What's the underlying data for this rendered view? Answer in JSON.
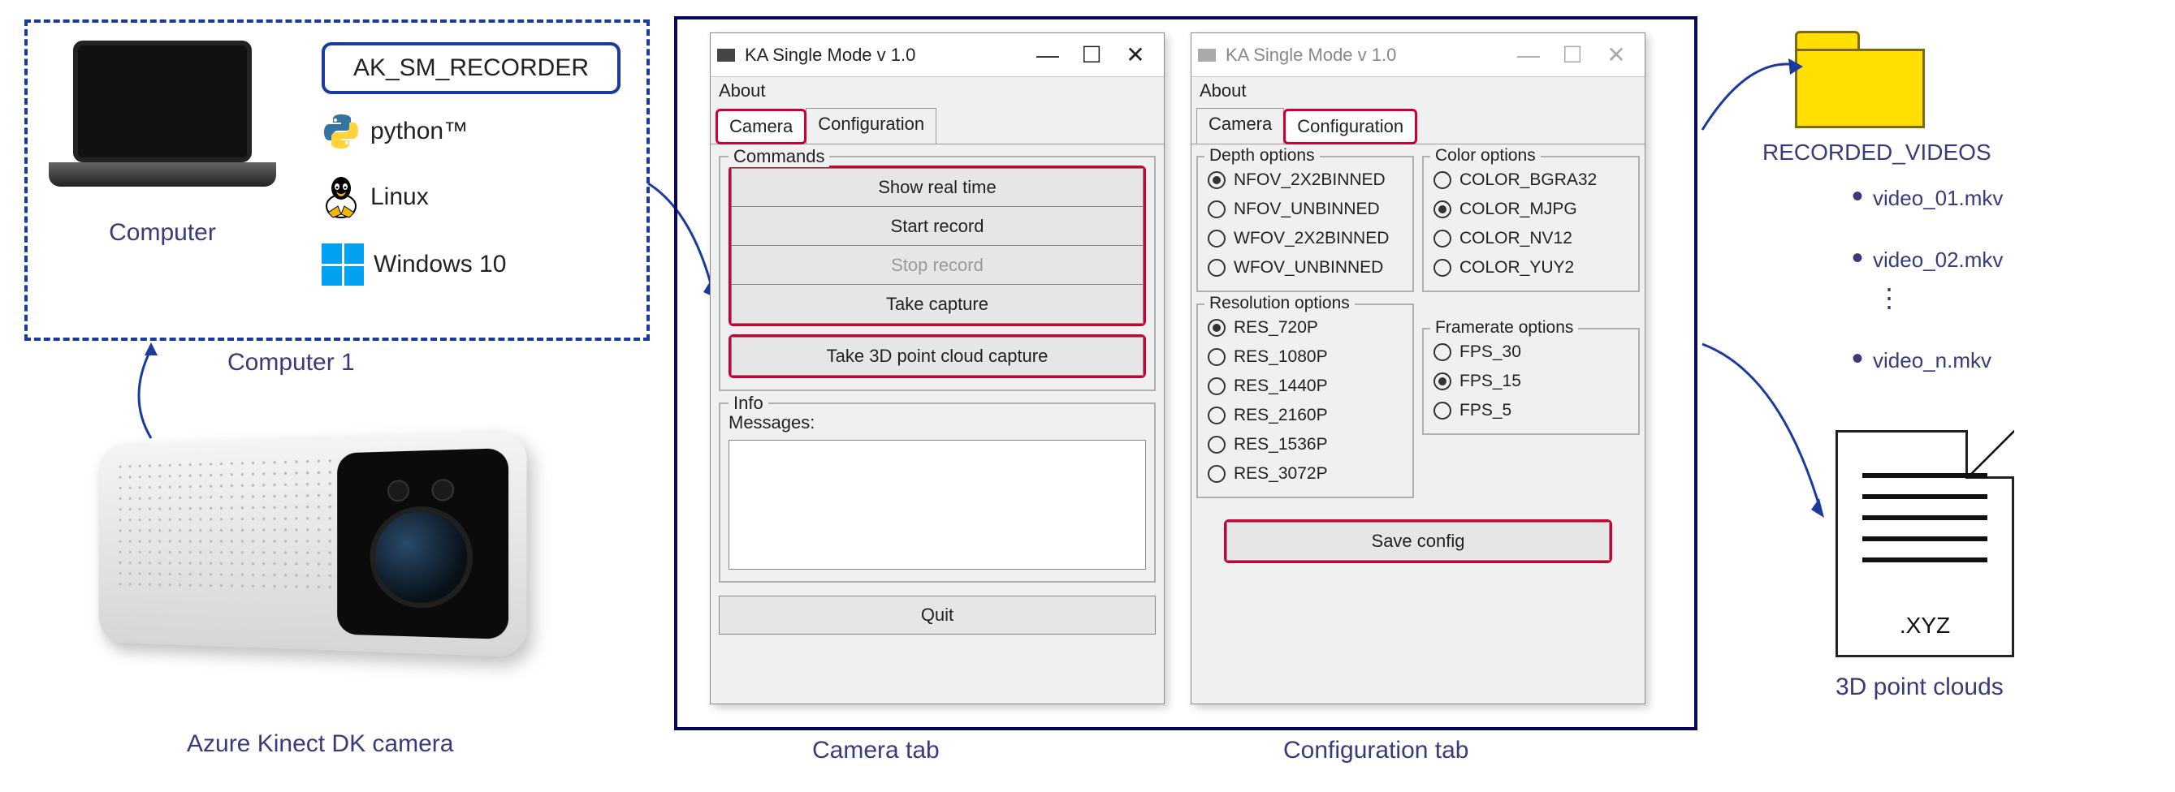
{
  "left": {
    "app_name": "AK_SM_RECORDER",
    "computer_label": "Computer",
    "computer1_label": "Computer 1",
    "tech": {
      "python": "python™",
      "linux": "Linux",
      "windows": "Windows 10"
    }
  },
  "camera": {
    "label": "Azure Kinect DK camera"
  },
  "windows": {
    "title": "KA Single Mode v 1.0",
    "menu_about": "About",
    "tabs": {
      "camera": "Camera",
      "configuration": "Configuration"
    },
    "camera_tab": {
      "caption": "Camera tab",
      "commands_title": "Commands",
      "buttons": {
        "show_real_time": "Show real time",
        "start_record": "Start record",
        "stop_record": "Stop record",
        "take_capture": "Take capture",
        "take_3d": "Take 3D point cloud capture"
      },
      "info_title": "Info",
      "messages_label": "Messages:",
      "quit": "Quit"
    },
    "config_tab": {
      "caption": "Configuration tab",
      "depth": {
        "title": "Depth options",
        "opts": [
          "NFOV_2X2BINNED",
          "NFOV_UNBINNED",
          "WFOV_2X2BINNED",
          "WFOV_UNBINNED"
        ],
        "selected": 0
      },
      "color": {
        "title": "Color options",
        "opts": [
          "COLOR_BGRA32",
          "COLOR_MJPG",
          "COLOR_NV12",
          "COLOR_YUY2"
        ],
        "selected": 1
      },
      "resolution": {
        "title": "Resolution options",
        "opts": [
          "RES_720P",
          "RES_1080P",
          "RES_1440P",
          "RES_2160P",
          "RES_1536P",
          "RES_3072P"
        ],
        "selected": 0
      },
      "framerate": {
        "title": "Framerate options",
        "opts": [
          "FPS_30",
          "FPS_15",
          "FPS_5"
        ],
        "selected": 1
      },
      "save_config": "Save config"
    }
  },
  "output": {
    "folder_label": "RECORDED_VIDEOS",
    "videos": [
      "video_01.mkv",
      "video_02.mkv",
      "video_n.mkv"
    ],
    "ellipsis": "⋮",
    "xyz_label": ".XYZ",
    "xyz_caption": "3D point clouds"
  }
}
